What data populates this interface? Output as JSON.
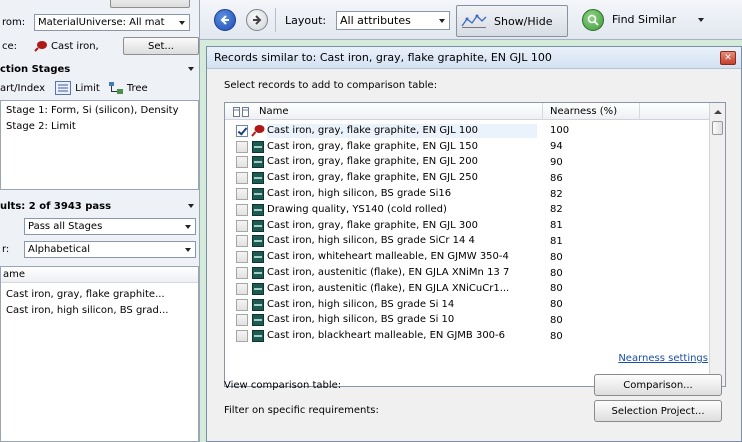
{
  "left_panel": {
    "top_cut": "...                               ",
    "from_label": "rom:",
    "from_value": "MaterialUniverse: All mat",
    "source_label": "ce:",
    "source_value": "Cast iron,",
    "set_button": "Set...",
    "section_stages": "ction Stages",
    "chart_index": "art/Index",
    "limit": "Limit",
    "tree": "Tree",
    "stages": [
      "Stage 1: Form, Si (silicon), Density",
      "Stage 2: Limit"
    ],
    "results_header": "ults: 2 of 3943 pass",
    "pass_filter": "Pass all Stages",
    "sort_label": "r:",
    "sort_value": "Alphabetical",
    "name_header": "ame",
    "results": [
      "Cast iron, gray, flake graphite...",
      "Cast iron, high silicon, BS grad..."
    ]
  },
  "toolbar": {
    "layout_label": "Layout:",
    "layout_value": "All attributes",
    "show_hide": "Show/Hide",
    "find_similar": "Find Similar"
  },
  "dialog": {
    "title": "Records similar to: Cast iron, gray, flake graphite, EN GJL 100",
    "instruction": "Select records to add to comparison table:",
    "col_name": "Name",
    "col_nearness": "Nearness (%)",
    "rows": [
      {
        "name": "Cast iron, gray, flake graphite, EN GJL 100",
        "nearness": "100",
        "checked": true
      },
      {
        "name": "Cast iron, gray, flake graphite, EN GJL 150",
        "nearness": "94",
        "checked": false
      },
      {
        "name": "Cast iron, gray, flake graphite, EN GJL 200",
        "nearness": "90",
        "checked": false
      },
      {
        "name": "Cast iron, gray, flake graphite, EN GJL 250",
        "nearness": "86",
        "checked": false
      },
      {
        "name": "Cast iron, high silicon, BS grade Si16",
        "nearness": "82",
        "checked": false
      },
      {
        "name": "Drawing quality, YS140 (cold rolled)",
        "nearness": "82",
        "checked": false
      },
      {
        "name": "Cast iron, gray, flake graphite, EN GJL 300",
        "nearness": "81",
        "checked": false
      },
      {
        "name": "Cast iron, high silicon, BS grade SiCr 14 4",
        "nearness": "81",
        "checked": false
      },
      {
        "name": "Cast iron, whiteheart malleable, EN GJMW 350-4",
        "nearness": "80",
        "checked": false
      },
      {
        "name": "Cast iron, austenitic (flake), EN GJLA XNiMn 13 7",
        "nearness": "80",
        "checked": false
      },
      {
        "name": "Cast iron, austenitic (flake), EN GJLA XNiCuCr1...",
        "nearness": "80",
        "checked": false
      },
      {
        "name": "Cast iron, high silicon, BS grade Si 14",
        "nearness": "80",
        "checked": false
      },
      {
        "name": "Cast iron, high silicon, BS grade Si 10",
        "nearness": "80",
        "checked": false
      },
      {
        "name": "Cast iron, blackheart malleable, EN GJMB 300-6",
        "nearness": "80",
        "checked": false
      }
    ],
    "nearness_settings": "Nearness settings",
    "view_comparison_label": "View comparison table:",
    "comparison_button": "Comparison...",
    "filter_label": "Filter on specific requirements:",
    "selection_project_button": "Selection Project..."
  }
}
